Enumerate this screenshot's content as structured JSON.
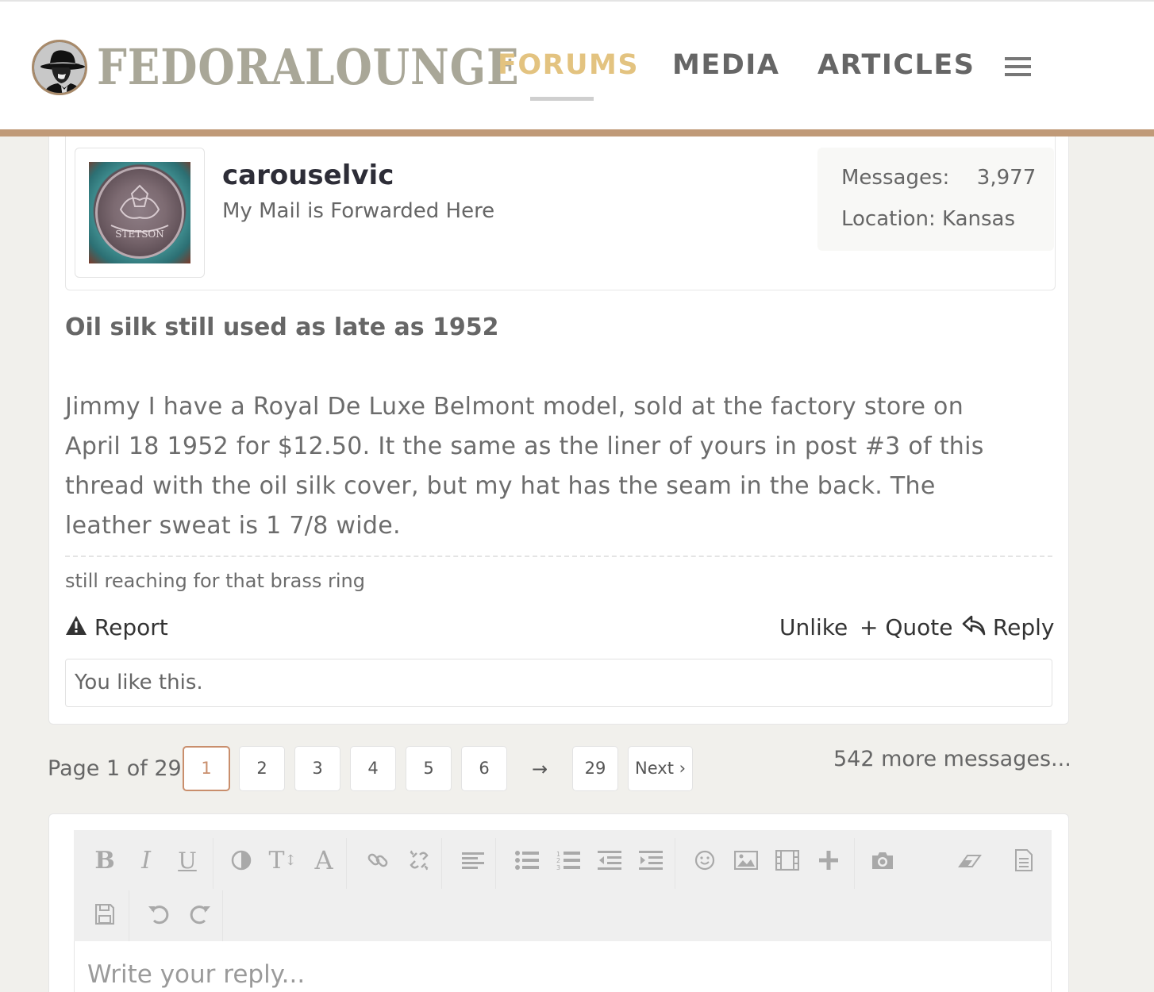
{
  "header": {
    "logo_text": "FEDORALOUNGE",
    "nav": [
      {
        "label": "FORUMS",
        "active": true
      },
      {
        "label": "MEDIA",
        "active": false
      },
      {
        "label": "ARTICLES",
        "active": false
      }
    ],
    "menu_icon": "hamburger-menu-icon",
    "accent_color": "#c09a78",
    "active_nav_color": "#e3c380"
  },
  "post": {
    "author": {
      "username": "carouselvic",
      "title": "My Mail is Forwarded Here",
      "avatar_text": "STETSON",
      "messages_label": "Messages:",
      "messages_value": "3,977",
      "location_label": "Location:",
      "location_value": "Kansas"
    },
    "title": "Oil silk still used as late as 1952",
    "body_lines": [
      "Jimmy I have a Royal De Luxe Belmont model, sold at the factory store on",
      "April 18 1952 for $12.50. It the same as the liner of yours in post #3 of this",
      "thread with the oil silk cover, but my hat has the seam in the back. The",
      "leather sweat is 1 7/8 wide."
    ],
    "signature": "still reaching for that brass ring",
    "actions": {
      "report": "Report",
      "unlike": "Unlike",
      "quote": "+ Quote",
      "reply": "Reply"
    },
    "likes_text": "You like this."
  },
  "pagination": {
    "label": "Page 1 of 29",
    "pages": [
      "1",
      "2",
      "3",
      "4",
      "5",
      "6"
    ],
    "current": "1",
    "skip": "→",
    "last": "29",
    "next": "Next ›",
    "more_messages": "542 more messages..."
  },
  "editor": {
    "placeholder": "Write your reply...",
    "toolbar_icons": [
      "bold-icon",
      "italic-icon",
      "underline-icon",
      "color-icon",
      "font-size-icon",
      "font-family-icon",
      "link-icon",
      "unlink-icon",
      "align-icon",
      "bullet-list-icon",
      "numbered-list-icon",
      "outdent-icon",
      "indent-icon",
      "smilie-icon",
      "image-icon",
      "media-icon",
      "insert-icon",
      "camera-icon",
      "remove-format-icon",
      "bbcode-icon",
      "save-draft-icon",
      "undo-icon",
      "redo-icon"
    ]
  }
}
